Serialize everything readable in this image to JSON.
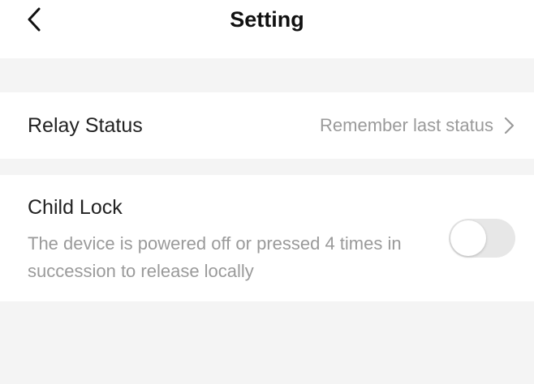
{
  "header": {
    "title": "Setting",
    "back_icon": "chevron-left-icon"
  },
  "relay_status": {
    "label": "Relay Status",
    "value": "Remember last status",
    "chevron_icon": "chevron-right-icon"
  },
  "child_lock": {
    "label": "Child Lock",
    "description": "The device is powered off or pressed 4 times in succession to release locally",
    "enabled": false
  },
  "colors": {
    "background": "#ffffff",
    "section_gap": "#f4f4f4",
    "primary_text": "#222222",
    "secondary_text": "#9a9a9a",
    "toggle_off": "#e7e7e7"
  }
}
